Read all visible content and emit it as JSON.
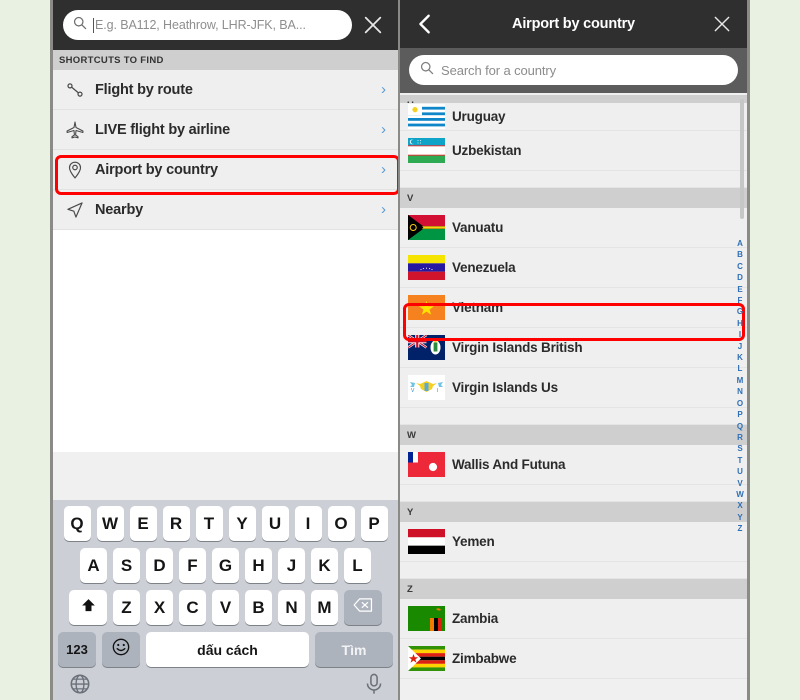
{
  "colors": {
    "page_background": "#e9f2e2",
    "topbar": "#2f2f2f",
    "panel": "#f0f0f0",
    "row": "#efefef",
    "section_header": "#cfcfcf",
    "highlight": "#ff0000",
    "chevron": "#5b9bd5",
    "index_text": "#2f6fb5",
    "keyboard_bg": "#ccd0d6",
    "key_white": "#ffffff",
    "key_modifier": "#adb3bd"
  },
  "left_panel": {
    "search": {
      "placeholder": "E.g. BA112, Heathrow, LHR-JFK, BA...",
      "value": "",
      "icon": "search-icon",
      "clear_icon": "close-icon",
      "has_caret": true
    },
    "section_label": "SHORTCUTS TO FIND",
    "shortcuts": [
      {
        "label": "Flight by route",
        "icon": "route-icon",
        "chevron": "›"
      },
      {
        "label": "LIVE flight by airline",
        "icon": "airplane-icon",
        "chevron": "›"
      },
      {
        "label": "Airport by country",
        "icon": "map-pin-icon",
        "chevron": "›",
        "highlighted": true
      },
      {
        "label": "Nearby",
        "icon": "navigation-icon",
        "chevron": "›"
      }
    ],
    "keyboard": {
      "language": "Vietnamese",
      "row1": [
        "Q",
        "W",
        "E",
        "R",
        "T",
        "Y",
        "U",
        "I",
        "O",
        "P"
      ],
      "row2": [
        "A",
        "S",
        "D",
        "F",
        "G",
        "H",
        "J",
        "K",
        "L"
      ],
      "row3": [
        "Z",
        "X",
        "C",
        "V",
        "B",
        "N",
        "M"
      ],
      "shift_icon": "shift-arrow-icon",
      "backspace_icon": "backspace-icon",
      "numbers_label": "123",
      "emoji_icon": "emoji-smiley-icon",
      "space_label": "dấu cách",
      "go_label": "Tìm",
      "globe_icon": "globe-icon",
      "mic_icon": "microphone-icon"
    }
  },
  "right_panel": {
    "header": {
      "title": "Airport by country",
      "back_icon": "chevron-left-icon",
      "close_icon": "close-icon"
    },
    "search": {
      "placeholder": "Search for a country",
      "value": "",
      "icon": "search-icon"
    },
    "sections": [
      {
        "letter": "U",
        "countries": [
          {
            "name": "Uruguay",
            "clipped": true
          },
          {
            "name": "Uzbekistan"
          }
        ]
      },
      {
        "letter": "V",
        "countries": [
          {
            "name": "Vanuatu"
          },
          {
            "name": "Venezuela"
          },
          {
            "name": "Vietnam",
            "highlighted": true
          },
          {
            "name": "Virgin Islands British"
          },
          {
            "name": "Virgin Islands Us"
          }
        ]
      },
      {
        "letter": "W",
        "countries": [
          {
            "name": "Wallis And Futuna"
          }
        ]
      },
      {
        "letter": "Y",
        "countries": [
          {
            "name": "Yemen"
          }
        ]
      },
      {
        "letter": "Z",
        "countries": [
          {
            "name": "Zambia"
          },
          {
            "name": "Zimbabwe"
          }
        ]
      }
    ],
    "alphabet_index": [
      "A",
      "B",
      "C",
      "D",
      "E",
      "F",
      "G",
      "H",
      "I",
      "J",
      "K",
      "L",
      "M",
      "N",
      "O",
      "P",
      "Q",
      "R",
      "S",
      "T",
      "U",
      "V",
      "W",
      "X",
      "Y",
      "Z"
    ]
  }
}
